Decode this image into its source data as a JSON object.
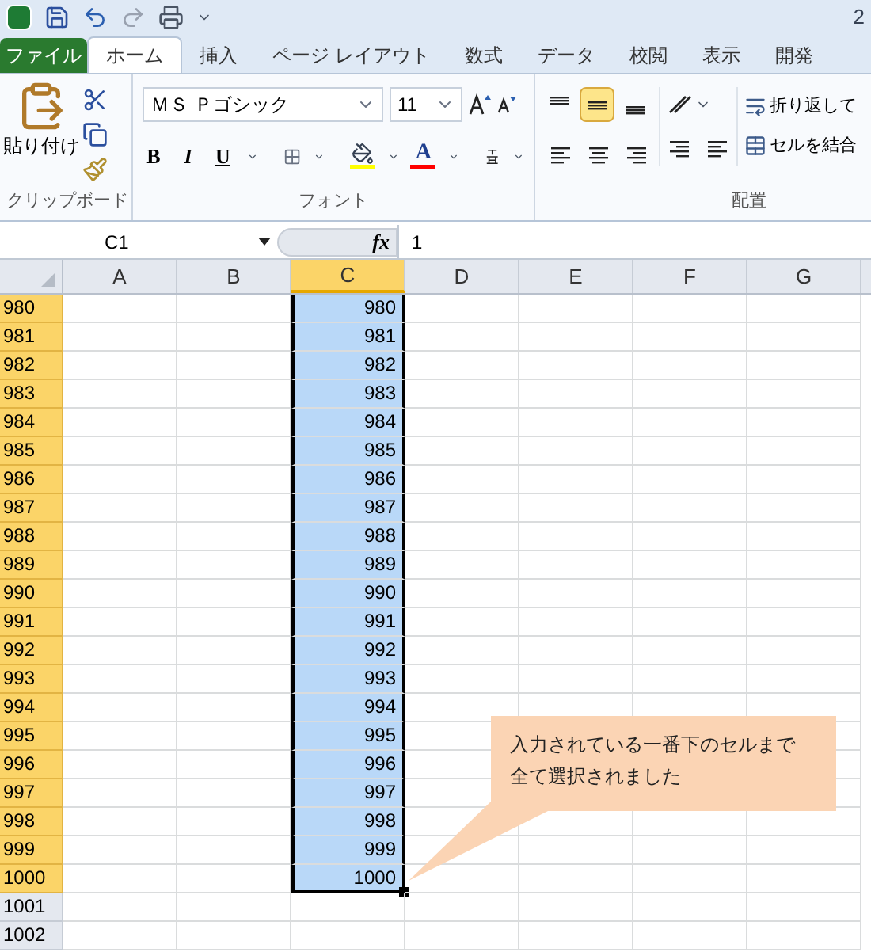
{
  "title_bar": {
    "text": "2"
  },
  "tabs": [
    {
      "label": "ファイル",
      "kind": "file",
      "selected": false
    },
    {
      "label": "ホーム",
      "kind": "tab",
      "selected": true
    },
    {
      "label": "挿入",
      "kind": "tab",
      "selected": false
    },
    {
      "label": "ページ レイアウト",
      "kind": "tab",
      "selected": false
    },
    {
      "label": "数式",
      "kind": "tab",
      "selected": false
    },
    {
      "label": "データ",
      "kind": "tab",
      "selected": false
    },
    {
      "label": "校閲",
      "kind": "tab",
      "selected": false
    },
    {
      "label": "表示",
      "kind": "tab",
      "selected": false
    },
    {
      "label": "開発",
      "kind": "tab",
      "selected": false
    }
  ],
  "clipboard": {
    "paste_label": "貼り付け",
    "group_label": "クリップボード"
  },
  "font": {
    "font_name": "ＭＳ Ｐゴシック",
    "font_size": "11",
    "bold": "B",
    "italic": "I",
    "underline": "U",
    "font_color_letter": "A",
    "group_label": "フォント"
  },
  "alignment": {
    "vertical": [
      {
        "kind": "top",
        "selected": false
      },
      {
        "kind": "middle",
        "selected": true
      },
      {
        "kind": "bottom",
        "selected": false
      }
    ],
    "wrap_label": "折り返して",
    "merge_label": "セルを結合",
    "group_label": "配置"
  },
  "formula_bar": {
    "name_box": "C1",
    "fx": "fx",
    "value": "1"
  },
  "columns": [
    {
      "label": "A",
      "selected": false
    },
    {
      "label": "B",
      "selected": false
    },
    {
      "label": "C",
      "selected": true
    },
    {
      "label": "D",
      "selected": false
    },
    {
      "label": "E",
      "selected": false
    },
    {
      "label": "F",
      "selected": false
    },
    {
      "label": "G",
      "selected": false
    }
  ],
  "rows": [
    {
      "header": "980",
      "c": "980",
      "selected": true
    },
    {
      "header": "981",
      "c": "981",
      "selected": true
    },
    {
      "header": "982",
      "c": "982",
      "selected": true
    },
    {
      "header": "983",
      "c": "983",
      "selected": true
    },
    {
      "header": "984",
      "c": "984",
      "selected": true
    },
    {
      "header": "985",
      "c": "985",
      "selected": true
    },
    {
      "header": "986",
      "c": "986",
      "selected": true
    },
    {
      "header": "987",
      "c": "987",
      "selected": true
    },
    {
      "header": "988",
      "c": "988",
      "selected": true
    },
    {
      "header": "989",
      "c": "989",
      "selected": true
    },
    {
      "header": "990",
      "c": "990",
      "selected": true
    },
    {
      "header": "991",
      "c": "991",
      "selected": true
    },
    {
      "header": "992",
      "c": "992",
      "selected": true
    },
    {
      "header": "993",
      "c": "993",
      "selected": true
    },
    {
      "header": "994",
      "c": "994",
      "selected": true
    },
    {
      "header": "995",
      "c": "995",
      "selected": true
    },
    {
      "header": "996",
      "c": "996",
      "selected": true
    },
    {
      "header": "997",
      "c": "997",
      "selected": true
    },
    {
      "header": "998",
      "c": "998",
      "selected": true
    },
    {
      "header": "999",
      "c": "999",
      "selected": true
    },
    {
      "header": "1000",
      "c": "1000",
      "selected": true
    },
    {
      "header": "1001",
      "selected": false
    },
    {
      "header": "1002",
      "selected": false
    }
  ],
  "callout": {
    "lines": [
      "入力されている一番下のセルまで",
      "全て選択されました"
    ]
  }
}
